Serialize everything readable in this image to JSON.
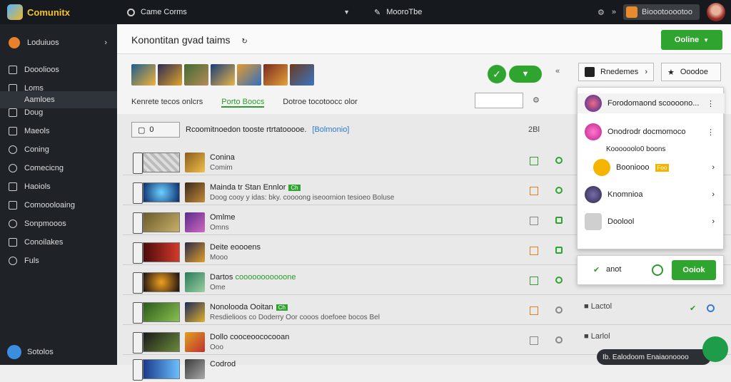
{
  "app": {
    "name": "Comunitx"
  },
  "topbar": {
    "tab1": "Came Corms",
    "tab2": "MooroTbe",
    "account": "Bioootooootoo"
  },
  "sidebar": {
    "items": [
      {
        "label": "Loduiuos"
      },
      {
        "label": "Dooolioos"
      },
      {
        "label": "Loms"
      },
      {
        "label": "Aamloes"
      },
      {
        "label": "Doug"
      },
      {
        "label": "Maeols"
      },
      {
        "label": "Coning"
      },
      {
        "label": "Comecicng"
      },
      {
        "label": "Haoiols"
      },
      {
        "label": "Comoooloaing"
      },
      {
        "label": "Sonpmooos"
      },
      {
        "label": "Conoilakes"
      },
      {
        "label": "Fuls"
      }
    ],
    "user": "Sotolos"
  },
  "main": {
    "title": "Konontitan gvad taims",
    "primary": "Ooline",
    "filters": [
      "Kenrete tecos onlcrs",
      "Porto Boocs",
      "Dotroe tocotoocc olor"
    ],
    "toolbar": {
      "manage": "Rnedemes",
      "settings": "Ooodoe"
    },
    "list_heading": "Rcoomitnoedon tooste rtrtatooooe.",
    "list_heading_link": "[Bolmonio]",
    "list_count": "2Bl",
    "search_icon_label": "0"
  },
  "rows": [
    {
      "title": "Conina",
      "sub": "Comim",
      "tag": ""
    },
    {
      "title": "Mainda tr Stan Ennlor",
      "sub": "Doog cooy y idas: bky. coooong iseoornion tesioeo Boluse",
      "tag": "Ch"
    },
    {
      "title": "Omlme",
      "sub": "Omns",
      "tag": ""
    },
    {
      "title": "Deite",
      "sub": "Mooo",
      "tag": "eoooens"
    },
    {
      "title": "Dartos",
      "sub": "Ome",
      "tag": "cooooooooooone"
    },
    {
      "title": "Nonolooda Ooitan",
      "sub": "Resdielioos co Doderry Oor cooos doefoee bocos Bel",
      "tag": "Ch"
    },
    {
      "title": "Dollo",
      "sub": "Ooo",
      "tag": "cooceoococooan"
    },
    {
      "title": "Codrod",
      "sub": "",
      "tag": ""
    }
  ],
  "row_side": [
    "Lactol",
    "Larlol"
  ],
  "dropdown": {
    "items": [
      {
        "label": "Forodomaond scoooono...",
        "color": "#d22f5e"
      },
      {
        "label": "Onodrodr docmomoco",
        "color": "#e040a0"
      },
      {
        "label": "Koooooolo0 boons",
        "color": ""
      },
      {
        "label": "Booniooo",
        "color": "#f4b400",
        "badge": "Foo"
      },
      {
        "label": "Knomnioa",
        "color": "#4a4f7a"
      },
      {
        "label": "Doolool",
        "color": "#aaaaaa"
      }
    ],
    "cancel": "anot",
    "ok": "Ooiok"
  },
  "toast": "Ib. Ealodoom Enaiaonoooo"
}
